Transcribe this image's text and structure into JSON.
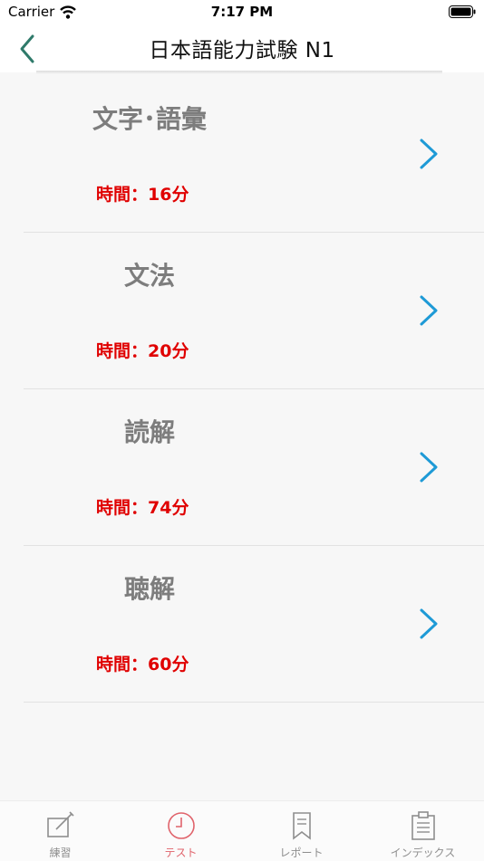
{
  "status_bar": {
    "carrier": "Carrier",
    "time": "7:17 PM"
  },
  "nav": {
    "title": "日本語能力試験 N1",
    "back_icon": "chevron-left-icon",
    "accent_color": "#2f7a6a"
  },
  "sections": [
    {
      "title": "文字･語彙",
      "time_label": "時間：",
      "time_value": "16分"
    },
    {
      "title": "文法",
      "time_label": "時間：",
      "time_value": "20分"
    },
    {
      "title": "読解",
      "time_label": "時間：",
      "time_value": "74分"
    },
    {
      "title": "聴解",
      "time_label": "時間：",
      "time_value": "60分"
    }
  ],
  "row_chevron_color": "#1e9ad6",
  "time_color": "#e00000",
  "tabs": [
    {
      "label": "練習",
      "icon": "pencil-note-icon",
      "active": false
    },
    {
      "label": "テスト",
      "icon": "clock-icon",
      "active": true
    },
    {
      "label": "レポート",
      "icon": "bookmark-icon",
      "active": false
    },
    {
      "label": "インデックス",
      "icon": "clipboard-icon",
      "active": false
    }
  ]
}
